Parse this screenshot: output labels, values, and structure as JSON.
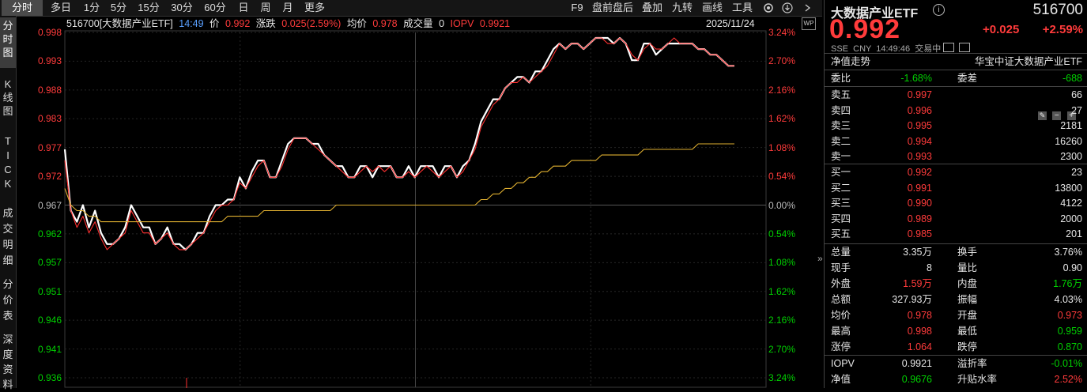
{
  "toolbar": {
    "tabs": [
      "分时",
      "多日",
      "1分",
      "5分",
      "15分",
      "30分",
      "60分",
      "日",
      "周",
      "月",
      "更多"
    ],
    "active_tab": "分时",
    "right_items": [
      "F9",
      "盘前盘后",
      "叠加",
      "九转",
      "画线",
      "工具"
    ]
  },
  "left_tabs": [
    {
      "label": "分时图",
      "active": true
    },
    {
      "label": "K线图",
      "active": false
    },
    {
      "label": "TICK",
      "active": false
    },
    {
      "label": "成交明细",
      "active": false
    },
    {
      "label": "分价表",
      "active": false
    },
    {
      "label": "深度资料",
      "active": false
    }
  ],
  "info": {
    "name": "516700[大数据产业ETF]",
    "time": "14:49",
    "price_label": "价",
    "price": "0.992",
    "change_label": "涨跌",
    "change": "0.025(2.59%)",
    "avg_label": "均价",
    "avg": "0.978",
    "volume_label": "成交量",
    "volume": "0",
    "iopv_label": "IOPV",
    "iopv": "0.9921",
    "date": "2025/11/24",
    "wp_badge": "WP"
  },
  "chart_data": {
    "type": "line",
    "base": 0.967,
    "ylim": [
      0.936,
      0.998
    ],
    "y_ticks_left": [
      "0.998",
      "0.993",
      "0.988",
      "0.983",
      "0.977",
      "0.972",
      "0.967",
      "0.962",
      "0.957",
      "0.951",
      "0.946",
      "0.941",
      "0.936"
    ],
    "y_ticks_right": [
      "3.24%",
      "2.70%",
      "2.16%",
      "1.62%",
      "1.08%",
      "0.54%",
      "0.00%",
      "0.54%",
      "1.08%",
      "1.62%",
      "2.16%",
      "2.70%",
      "3.24%"
    ],
    "series": [
      {
        "color": "#ffffff",
        "values": [
          0.977,
          0.966,
          0.964,
          0.967,
          0.963,
          0.966,
          0.962,
          0.96,
          0.96,
          0.961,
          0.963,
          0.967,
          0.965,
          0.963,
          0.963,
          0.96,
          0.961,
          0.963,
          0.96,
          0.96,
          0.959,
          0.96,
          0.962,
          0.962,
          0.965,
          0.967,
          0.967,
          0.968,
          0.968,
          0.972,
          0.97,
          0.973,
          0.975,
          0.975,
          0.972,
          0.972,
          0.975,
          0.978,
          0.979,
          0.979,
          0.979,
          0.978,
          0.978,
          0.976,
          0.975,
          0.974,
          0.974,
          0.972,
          0.972,
          0.974,
          0.974,
          0.972,
          0.974,
          0.974,
          0.974,
          0.972,
          0.972,
          0.974,
          0.972,
          0.974,
          0.974,
          0.974,
          0.972,
          0.974,
          0.974,
          0.972,
          0.974,
          0.975,
          0.978,
          0.982,
          0.984,
          0.986,
          0.986,
          0.988,
          0.989,
          0.99,
          0.99,
          0.989,
          0.991,
          0.991,
          0.993,
          0.995,
          0.996,
          0.995,
          0.996,
          0.996,
          0.995,
          0.996,
          0.997,
          0.997,
          0.997,
          0.996,
          0.997,
          0.996,
          0.993,
          0.993,
          0.996,
          0.996,
          0.994,
          0.995,
          0.996,
          0.996,
          0.996,
          0.996,
          0.996,
          0.995,
          0.995,
          0.994,
          0.994,
          0.993,
          0.992,
          0.992
        ]
      },
      {
        "color": "#ff3030",
        "values": [
          0.975,
          0.966,
          0.963,
          0.965,
          0.962,
          0.964,
          0.961,
          0.959,
          0.96,
          0.961,
          0.962,
          0.966,
          0.964,
          0.962,
          0.962,
          0.96,
          0.961,
          0.962,
          0.96,
          0.959,
          0.959,
          0.96,
          0.961,
          0.962,
          0.964,
          0.966,
          0.967,
          0.967,
          0.968,
          0.971,
          0.97,
          0.972,
          0.974,
          0.975,
          0.972,
          0.972,
          0.974,
          0.977,
          0.979,
          0.979,
          0.979,
          0.978,
          0.977,
          0.976,
          0.975,
          0.974,
          0.973,
          0.972,
          0.972,
          0.973,
          0.974,
          0.973,
          0.974,
          0.973,
          0.974,
          0.972,
          0.972,
          0.973,
          0.972,
          0.973,
          0.974,
          0.973,
          0.972,
          0.973,
          0.974,
          0.972,
          0.973,
          0.975,
          0.977,
          0.981,
          0.983,
          0.985,
          0.986,
          0.988,
          0.989,
          0.989,
          0.99,
          0.989,
          0.99,
          0.991,
          0.992,
          0.994,
          0.996,
          0.995,
          0.996,
          0.996,
          0.995,
          0.996,
          0.997,
          0.997,
          0.996,
          0.996,
          0.997,
          0.996,
          0.994,
          0.993,
          0.995,
          0.996,
          0.995,
          0.995,
          0.996,
          0.997,
          0.996,
          0.996,
          0.996,
          0.995,
          0.995,
          0.994,
          0.994,
          0.993,
          0.992,
          0.992
        ]
      },
      {
        "color": "#e0b030",
        "values": [
          0.97,
          0.967,
          0.966,
          0.966,
          0.965,
          0.965,
          0.964,
          0.964,
          0.964,
          0.964,
          0.964,
          0.964,
          0.964,
          0.964,
          0.964,
          0.964,
          0.964,
          0.964,
          0.964,
          0.964,
          0.964,
          0.964,
          0.964,
          0.964,
          0.964,
          0.964,
          0.964,
          0.965,
          0.965,
          0.965,
          0.965,
          0.965,
          0.965,
          0.966,
          0.966,
          0.966,
          0.966,
          0.966,
          0.966,
          0.966,
          0.966,
          0.966,
          0.966,
          0.966,
          0.966,
          0.967,
          0.967,
          0.967,
          0.967,
          0.967,
          0.967,
          0.967,
          0.967,
          0.967,
          0.967,
          0.967,
          0.967,
          0.967,
          0.967,
          0.967,
          0.967,
          0.967,
          0.967,
          0.967,
          0.967,
          0.967,
          0.967,
          0.967,
          0.967,
          0.968,
          0.968,
          0.969,
          0.969,
          0.97,
          0.97,
          0.971,
          0.971,
          0.972,
          0.972,
          0.973,
          0.973,
          0.974,
          0.974,
          0.974,
          0.975,
          0.975,
          0.975,
          0.975,
          0.975,
          0.976,
          0.976,
          0.976,
          0.976,
          0.976,
          0.976,
          0.976,
          0.977,
          0.977,
          0.977,
          0.977,
          0.977,
          0.977,
          0.977,
          0.977,
          0.977,
          0.978,
          0.978,
          0.978,
          0.978,
          0.978,
          0.978,
          0.978
        ]
      }
    ]
  },
  "panel": {
    "title": "大数据产业ETF",
    "code": "516700",
    "price": "0.992",
    "change": "+0.025",
    "change_pct": "+2.59%",
    "sub": "SSE  CNY  14:49:46  交易中",
    "nav_trend_label": "净值走势",
    "index_name": "华宝中证大数据产业ETF",
    "weibi_label": "委比",
    "weibi": "-1.68%",
    "weicha_label": "委差",
    "weicha": "-688",
    "asks": [
      {
        "label": "卖五",
        "price": "0.997",
        "vol": "66"
      },
      {
        "label": "卖四",
        "price": "0.996",
        "vol": "27"
      },
      {
        "label": "卖三",
        "price": "0.995",
        "vol": "2181"
      },
      {
        "label": "卖二",
        "price": "0.994",
        "vol": "16260"
      },
      {
        "label": "卖一",
        "price": "0.993",
        "vol": "2300"
      }
    ],
    "bids": [
      {
        "label": "买一",
        "price": "0.992",
        "vol": "23"
      },
      {
        "label": "买二",
        "price": "0.991",
        "vol": "13800"
      },
      {
        "label": "买三",
        "price": "0.990",
        "vol": "4122"
      },
      {
        "label": "买四",
        "price": "0.989",
        "vol": "2000"
      },
      {
        "label": "买五",
        "price": "0.985",
        "vol": "201"
      }
    ],
    "stats": [
      {
        "l1": "总量",
        "v1": "3.35万",
        "c1": "white",
        "l2": "换手",
        "v2": "3.76%",
        "c2": "white"
      },
      {
        "l1": "现手",
        "v1": "8",
        "c1": "white",
        "l2": "量比",
        "v2": "0.90",
        "c2": "white"
      },
      {
        "l1": "外盘",
        "v1": "1.59万",
        "c1": "red",
        "l2": "内盘",
        "v2": "1.76万",
        "c2": "green"
      },
      {
        "l1": "总额",
        "v1": "327.93万",
        "c1": "white",
        "l2": "振幅",
        "v2": "4.03%",
        "c2": "white"
      },
      {
        "l1": "均价",
        "v1": "0.978",
        "c1": "red",
        "l2": "开盘",
        "v2": "0.973",
        "c2": "red"
      },
      {
        "l1": "最高",
        "v1": "0.998",
        "c1": "red",
        "l2": "最低",
        "v2": "0.959",
        "c2": "green"
      },
      {
        "l1": "涨停",
        "v1": "1.064",
        "c1": "red",
        "l2": "跌停",
        "v2": "0.870",
        "c2": "green"
      }
    ],
    "stats2": [
      {
        "l1": "IOPV",
        "v1": "0.9921",
        "c1": "white",
        "l2": "溢折率",
        "v2": "-0.01%",
        "c2": "green"
      },
      {
        "l1": "净值",
        "v1": "0.9676",
        "c1": "green",
        "l2": "升贴水率",
        "v2": "2.52%",
        "c2": "red"
      }
    ]
  }
}
